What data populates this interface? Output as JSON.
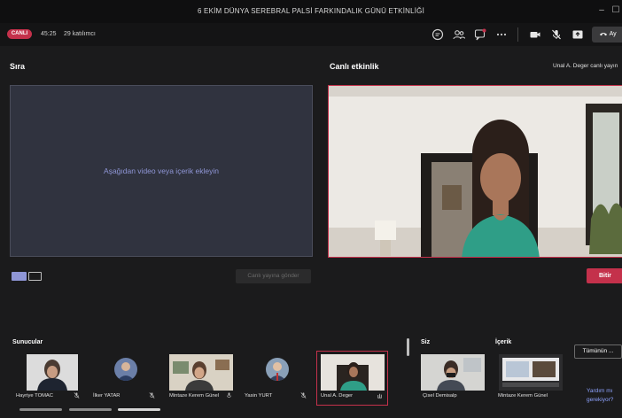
{
  "window": {
    "title": "6 EKİM DÜNYA SEREBRAL PALSİ FARKINDALIK GÜNÜ ETKİNLİĞİ",
    "minimize": "–",
    "maximize": "☐"
  },
  "toolbar": {
    "live_badge": "CANLI",
    "time": "45:25",
    "attendees": "29 katılımcı",
    "leave_label": "Ay"
  },
  "left_panel": {
    "title": "Sıra",
    "placeholder": "Aşağıdan video veya içerik ekleyin",
    "send_button": "Canlı yayına gönder"
  },
  "right_panel": {
    "title": "Canlı etkinlik",
    "status": "Unal A. Deger canlı yayın",
    "end_button": "Bitir"
  },
  "presenters": {
    "label": "Sunucular",
    "items": [
      {
        "name": "Hayriye TOMAC"
      },
      {
        "name": "İlker YATAR"
      },
      {
        "name": "Mintaze Kerem Günel"
      },
      {
        "name": "Yasin YURT"
      },
      {
        "name": "Unal A. Deger"
      }
    ]
  },
  "you": {
    "label": "Siz",
    "name": "Çisel Demisalp"
  },
  "content": {
    "label": "İçerik",
    "name": "Mintaze Kerem Günel"
  },
  "side": {
    "all_button": "Tümünün ...",
    "help_line1": "Yardım mı",
    "help_line2": "gerekiyor?"
  },
  "colors": {
    "accent_red": "#c4314b",
    "queue_bg": "#30333f",
    "link_blue": "#8ea3ff"
  }
}
